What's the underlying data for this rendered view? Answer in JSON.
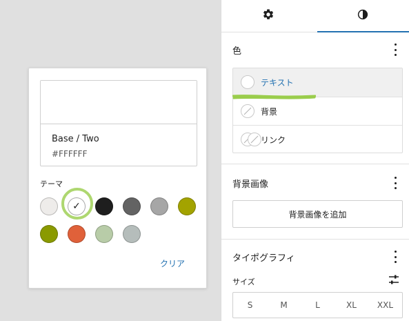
{
  "popover": {
    "preview_name": "Base / Two",
    "preview_hex": "#FFFFFF",
    "theme_label": "テーマ",
    "clear_label": "クリア",
    "swatches": [
      {
        "color": "#eeecea",
        "selected": false
      },
      {
        "color": "#ffffff",
        "selected": true
      },
      {
        "color": "#1e1e1e",
        "selected": false
      },
      {
        "color": "#636363",
        "selected": false
      },
      {
        "color": "#a6a6a6",
        "selected": false
      },
      {
        "color": "#a3a300",
        "selected": false
      },
      {
        "color": "#8a9a00",
        "selected": false
      },
      {
        "color": "#e0613a",
        "selected": false
      },
      {
        "color": "#b8cca8",
        "selected": false
      },
      {
        "color": "#b5bdbb",
        "selected": false
      }
    ]
  },
  "sidebar": {
    "tabs": [
      {
        "name": "settings",
        "icon": "gear-icon"
      },
      {
        "name": "styles",
        "icon": "half-circle-icon"
      }
    ],
    "color_section": {
      "title": "色",
      "items": [
        {
          "label": "テキスト",
          "selected": true
        },
        {
          "label": "背景",
          "selected": false
        },
        {
          "label": "リンク",
          "selected": false
        }
      ]
    },
    "background_section": {
      "title": "背景画像",
      "add_button": "背景画像を追加"
    },
    "typography_section": {
      "title": "タイポグラフィ",
      "size_label": "サイズ",
      "sizes": [
        "S",
        "M",
        "L",
        "XL",
        "XXL"
      ]
    }
  },
  "colors": {
    "accent": "#2271b1",
    "highlight": "#9acd4c"
  }
}
